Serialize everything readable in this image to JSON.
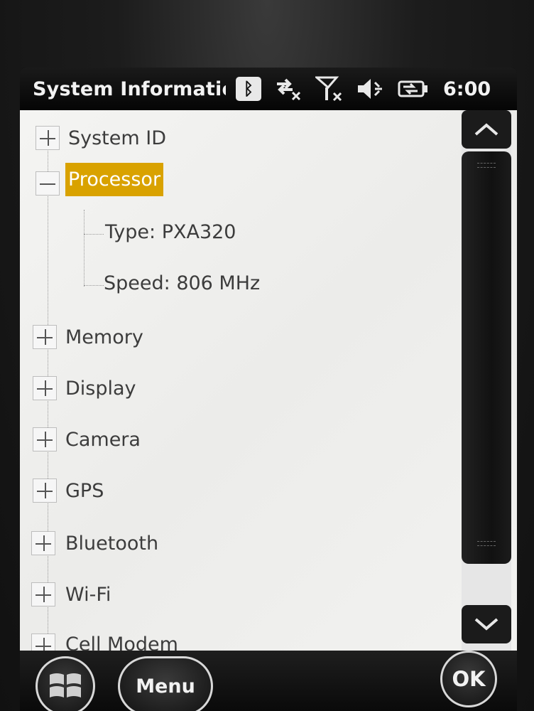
{
  "titlebar": {
    "title": "System Informatio",
    "clock": "6:00",
    "icons": [
      "bluetooth-icon",
      "data-connection-icon",
      "signal-off-icon",
      "volume-muted-icon",
      "battery-charging-icon"
    ]
  },
  "tree": {
    "nodes": [
      {
        "label": "System ID",
        "expanded": false
      },
      {
        "label": "Processor",
        "expanded": true,
        "selected": true,
        "children": [
          "Type: PXA320",
          "Speed: 806 MHz"
        ]
      },
      {
        "label": "Memory",
        "expanded": false
      },
      {
        "label": "Display",
        "expanded": false
      },
      {
        "label": "Camera",
        "expanded": false
      },
      {
        "label": "GPS",
        "expanded": false
      },
      {
        "label": "Bluetooth",
        "expanded": false
      },
      {
        "label": "Wi-Fi",
        "expanded": false
      },
      {
        "label": "Cell Modem",
        "expanded": false
      }
    ]
  },
  "softkeys": {
    "menu_label": "Menu",
    "ok_label": "OK"
  },
  "colors": {
    "selection": "#d9a200",
    "background": "#f0f0ee",
    "bar": "#0a0a0a"
  }
}
